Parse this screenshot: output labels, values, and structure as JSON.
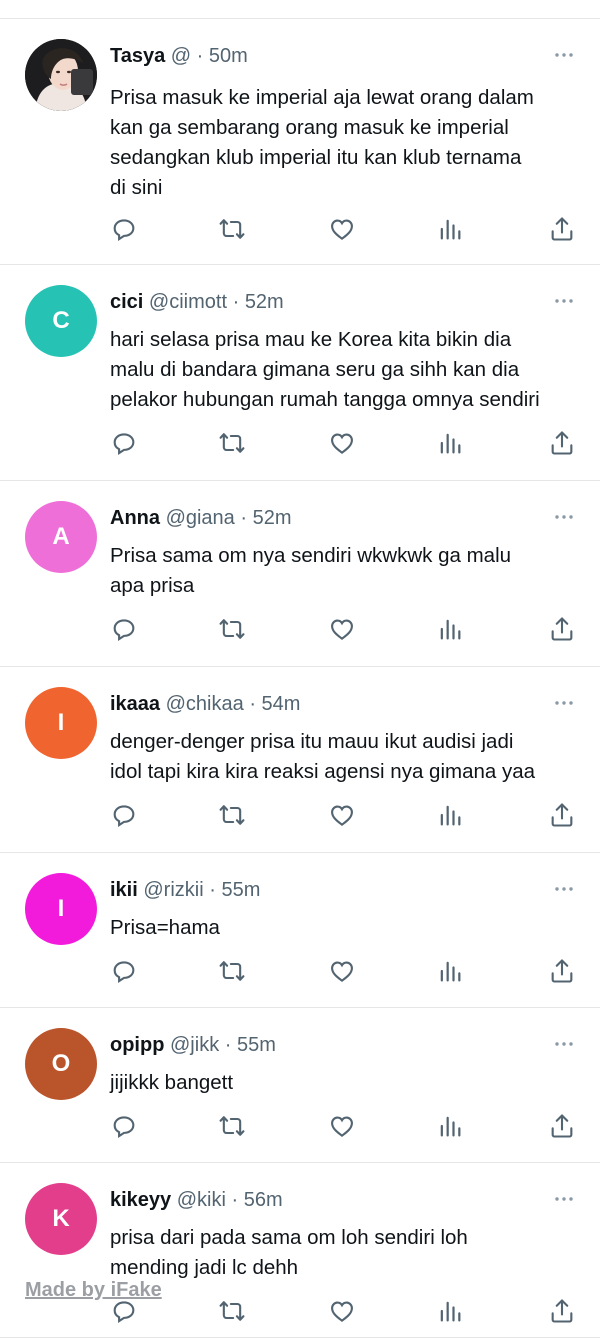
{
  "tweets": [
    {
      "avatar_letter": "",
      "avatar_color": "#2a2a2a",
      "name": "Tasya",
      "handle": "@",
      "time": "50m",
      "text": "Prisa masuk ke imperial aja lewat orang dalam\nkan ga sembarang orang masuk ke imperial\nsedangkan klub imperial itu kan klub ternama\ndi sini"
    },
    {
      "avatar_letter": "C",
      "avatar_color": "#26c2b4",
      "name": "cici",
      "handle": "@ciimott",
      "time": "52m",
      "text": "hari selasa prisa mau ke Korea kita bikin dia\nmalu di bandara gimana seru ga sihh kan dia\npelakor hubungan rumah tangga omnya sendiri"
    },
    {
      "avatar_letter": "A",
      "avatar_color": "#ef6fd9",
      "name": "Anna",
      "handle": "@giana",
      "time": "52m",
      "text": "Prisa sama om nya sendiri wkwkwk ga malu\napa prisa"
    },
    {
      "avatar_letter": "I",
      "avatar_color": "#f0642f",
      "name": "ikaaa",
      "handle": "@chikaa",
      "time": "54m",
      "text": "denger-denger prisa itu mauu ikut audisi jadi\nidol tapi kira kira reaksi agensi nya gimana yaa"
    },
    {
      "avatar_letter": "I",
      "avatar_color": "#f21bdc",
      "name": "ikii",
      "handle": "@rizkii",
      "time": "55m",
      "text": "Prisa=hama"
    },
    {
      "avatar_letter": "O",
      "avatar_color": "#b9542b",
      "name": "opipp",
      "handle": "@jikk",
      "time": "55m",
      "text": "jijikkk bangett"
    },
    {
      "avatar_letter": "K",
      "avatar_color": "#e23e8c",
      "name": "kikeyy",
      "handle": "@kiki",
      "time": "56m",
      "text": "prisa dari pada sama om loh sendiri loh\nmending jadi lc dehh"
    }
  ],
  "separator": "·",
  "icons": {
    "more": "more-dots-icon",
    "reply": "reply-icon",
    "retweet": "retweet-icon",
    "like": "heart-icon",
    "views": "views-icon",
    "share": "share-icon"
  },
  "watermark": "Made by iFake"
}
